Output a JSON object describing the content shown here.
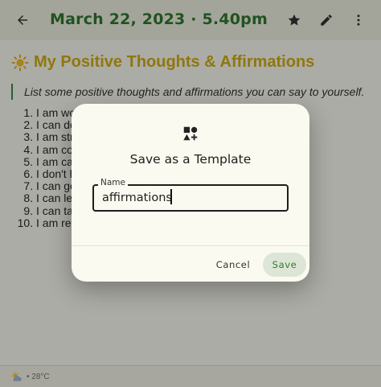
{
  "appbar": {
    "title": "March 22, 2023 · 5.40pm",
    "icons": [
      "back-arrow-icon",
      "star-icon",
      "pencil-icon",
      "more-vertical-icon"
    ]
  },
  "note": {
    "heading": "My Positive Thoughts & Affirmations",
    "quote": "List some positive thoughts and affirmations you can say to yourself.",
    "items": [
      "I am wo",
      "I can do",
      "I am str",
      "I am co",
      "I am ca",
      "I don't h",
      "I can ge",
      "I can let",
      "I can ta",
      "I am rea"
    ]
  },
  "bottombar": {
    "weather_icon": "partly-sunny-icon",
    "temperature": "• 28°C"
  },
  "dialog": {
    "icon": "shapes-add-icon",
    "title": "Save as a Template",
    "field_label": "Name",
    "field_value": "affirmations",
    "cancel_label": "Cancel",
    "save_label": "Save"
  },
  "colors": {
    "title_green": "#1f6b1f",
    "heading_gold": "#caa400",
    "accent_green": "#2e7d32",
    "save_button_bg": "#dde6d6"
  }
}
